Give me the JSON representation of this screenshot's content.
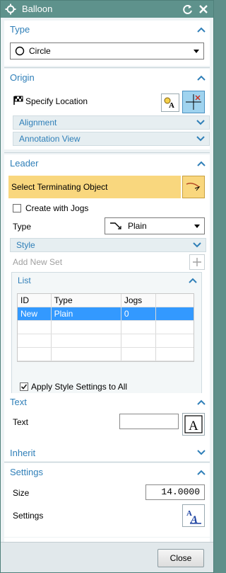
{
  "window": {
    "title": "Balloon"
  },
  "type_group": {
    "header": "Type",
    "selected": "Circle"
  },
  "origin_group": {
    "header": "Origin",
    "specify_location": "Specify Location",
    "alignment": "Alignment",
    "annotation_view": "Annotation View"
  },
  "leader_group": {
    "header": "Leader",
    "select_terminating": "Select Terminating Object",
    "create_with_jogs": "Create with Jogs",
    "type_label": "Type",
    "type_value": "Plain",
    "style": "Style",
    "add_new_set": "Add New Set",
    "list": {
      "header": "List",
      "columns": [
        "ID",
        "Type",
        "Jogs",
        ""
      ],
      "rows": [
        [
          "New",
          "Plain",
          "0",
          ""
        ]
      ],
      "apply_style": "Apply Style Settings to All"
    }
  },
  "text_group": {
    "header": "Text",
    "text_label": "Text",
    "text_value": ""
  },
  "inherit_group": {
    "header": "Inherit"
  },
  "settings_group": {
    "header": "Settings",
    "size_label": "Size",
    "size_value": "14.0000",
    "settings_label": "Settings"
  },
  "footer": {
    "close": "Close"
  },
  "colors": {
    "titlebar": "#5e928c",
    "header_text": "#2f7fb8",
    "selection": "#3399ff",
    "highlight": "#f9d77e"
  }
}
